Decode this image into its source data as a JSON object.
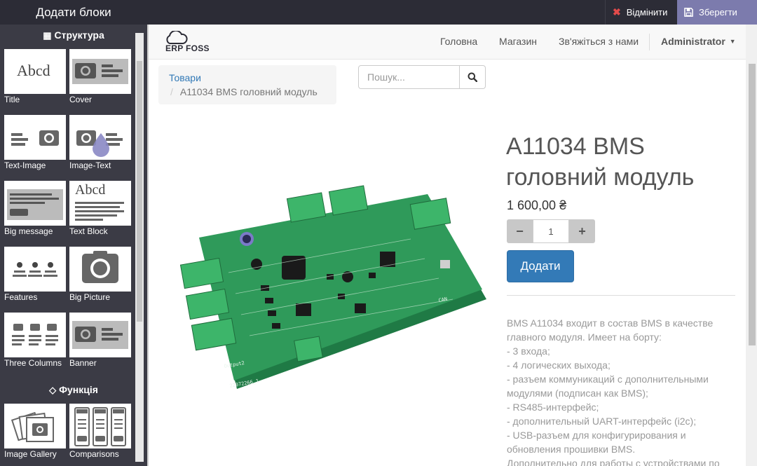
{
  "topbar": {
    "title": "Додати блоки",
    "discard_label": "Відмінити",
    "save_label": "Зберегти"
  },
  "sidebar": {
    "sections": [
      {
        "label": "Структура",
        "icon": "grid-icon",
        "blocks": [
          {
            "label": "Title",
            "thumb": "title-thumb-icon"
          },
          {
            "label": "Cover",
            "thumb": "cover-thumb-icon"
          },
          {
            "label": "Text-Image",
            "thumb": "text-image-thumb-icon"
          },
          {
            "label": "Image-Text",
            "thumb": "image-text-thumb-icon"
          },
          {
            "label": "Big message",
            "thumb": "big-message-thumb-icon"
          },
          {
            "label": "Text Block",
            "thumb": "text-block-thumb-icon"
          },
          {
            "label": "Features",
            "thumb": "features-thumb-icon"
          },
          {
            "label": "Big Picture",
            "thumb": "big-picture-thumb-icon"
          },
          {
            "label": "Three Columns",
            "thumb": "three-columns-thumb-icon"
          },
          {
            "label": "Banner",
            "thumb": "banner-thumb-icon"
          }
        ]
      },
      {
        "label": "Функція",
        "icon": "diamond-icon",
        "blocks": [
          {
            "label": "Image Gallery",
            "thumb": "image-gallery-thumb-icon"
          },
          {
            "label": "Comparisons",
            "thumb": "comparisons-thumb-icon"
          }
        ]
      }
    ],
    "title_thumb_text": "Abcd"
  },
  "navbar": {
    "logo_text": "ERP FOSS",
    "links": [
      "Головна",
      "Магазин",
      "Зв'яжіться з нами"
    ],
    "user": "Administrator"
  },
  "breadcrumb": {
    "root": "Товари",
    "current": "A11034 BMS головний модуль"
  },
  "search": {
    "placeholder": "Пошук..."
  },
  "product": {
    "title": "A11034 BMS головний модуль",
    "price": "1 600,00 ₴",
    "quantity": "1",
    "add_label": "Додати",
    "description": [
      "BMS A11034 входит в состав BMS в качестве главного модуля. Имеет на борту:",
      "- 3 входа;",
      "- 4 логических выхода;",
      "- разъем коммуникаций с дополнительными модулями (подписан как BMS);",
      "- RS485-интерфейс;",
      "- дополнительный UART-интерфейс (i2c);",
      "- USB-разъем для конфигурирования и обновления прошивки BMS.",
      "Дополнительно для работы с устройствами по"
    ]
  },
  "colors": {
    "topbar": "#2c2c36",
    "sidebar": "#3b3b45",
    "save": "#7c7bad",
    "discard_icon": "#e34b4b",
    "primary": "#337ab7",
    "pcb": "#2f9a5a",
    "terminal": "#3db56a"
  }
}
